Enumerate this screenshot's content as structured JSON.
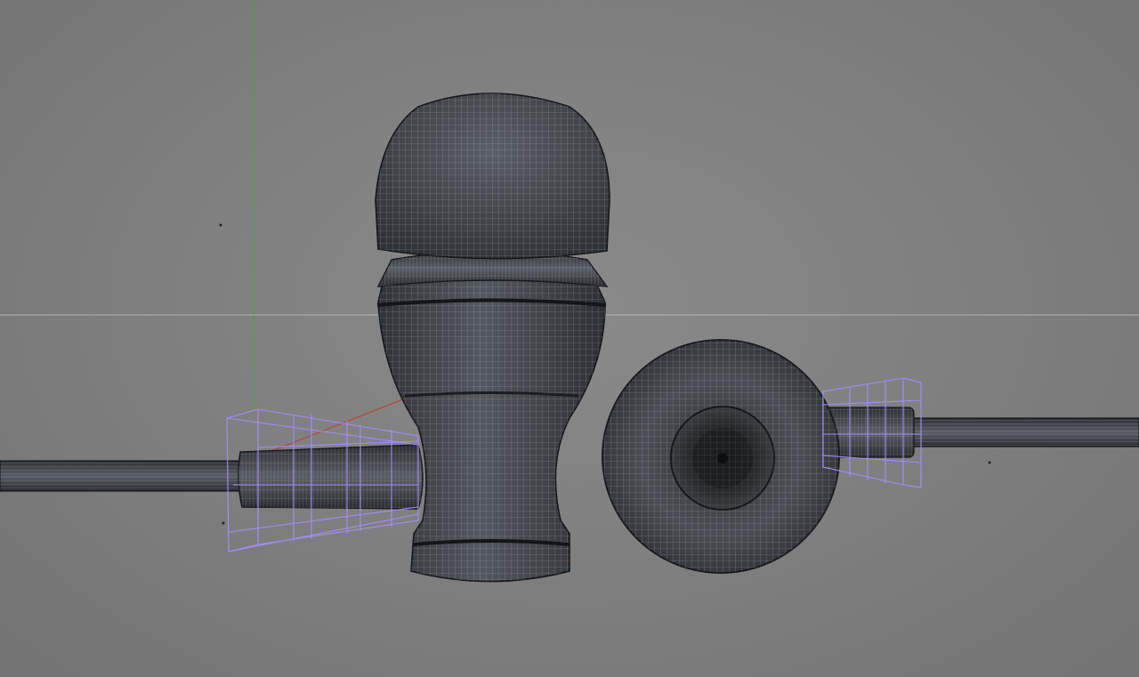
{
  "viewport": {
    "background": "#7d7d7d",
    "mesh_fill": "#3a3d42",
    "mesh_wire": "#b9bdc2",
    "mesh_outline": "#141518",
    "selection_color": "#a58cff",
    "axis_y_color": "#3fa83f",
    "axis_x_color": "#c0392b",
    "horizon_color": "#b4b4b4"
  },
  "scene": {
    "objects": [
      {
        "name": "earbud-side-view",
        "type": "polygon-mesh"
      },
      {
        "name": "earbud-front-view",
        "type": "polygon-mesh"
      },
      {
        "name": "cable-left",
        "type": "polygon-mesh"
      },
      {
        "name": "cable-right",
        "type": "polygon-mesh"
      }
    ]
  }
}
